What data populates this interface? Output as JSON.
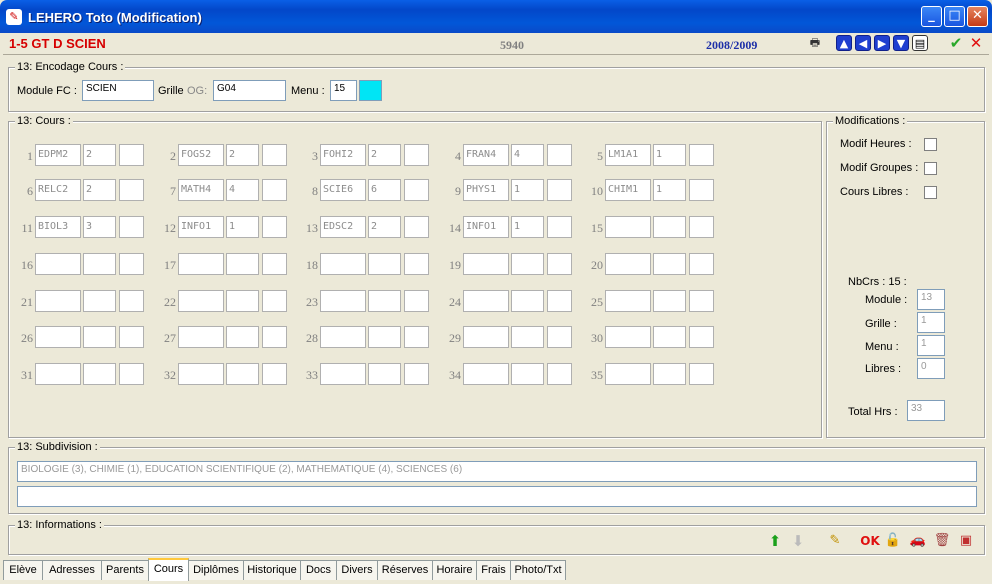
{
  "window": {
    "title": "LEHERO Toto (Modification)"
  },
  "infobar": {
    "code": "1-5 GT D SCIEN",
    "number": "5940",
    "year": "2008/2009"
  },
  "encodage": {
    "legend": "13: Encodage Cours :",
    "module_label": "Module FC :",
    "module_value": "SCIEN",
    "grille_label": "Grille",
    "og_label": "OG:",
    "grille_value": "G04",
    "menu_label": "Menu :",
    "menu_value": "15"
  },
  "cours": {
    "legend": "13: Cours :",
    "items": [
      {
        "n": "1",
        "code": "EDPM2",
        "hrs": "2"
      },
      {
        "n": "2",
        "code": "FOGS2",
        "hrs": "2"
      },
      {
        "n": "3",
        "code": "FOHI2",
        "hrs": "2"
      },
      {
        "n": "4",
        "code": "FRAN4",
        "hrs": "4"
      },
      {
        "n": "5",
        "code": "LM1A1",
        "hrs": "1"
      },
      {
        "n": "6",
        "code": "RELC2",
        "hrs": "2"
      },
      {
        "n": "7",
        "code": "MATH4",
        "hrs": "4"
      },
      {
        "n": "8",
        "code": "SCIE6",
        "hrs": "6"
      },
      {
        "n": "9",
        "code": "PHYS1",
        "hrs": "1"
      },
      {
        "n": "10",
        "code": "CHIM1",
        "hrs": "1"
      },
      {
        "n": "11",
        "code": "BIOL3",
        "hrs": "3"
      },
      {
        "n": "12",
        "code": "INFO1",
        "hrs": "1"
      },
      {
        "n": "13",
        "code": "EDSC2",
        "hrs": "2"
      },
      {
        "n": "14",
        "code": "INFO1",
        "hrs": "1"
      },
      {
        "n": "15",
        "code": "",
        "hrs": ""
      },
      {
        "n": "16",
        "code": "",
        "hrs": ""
      },
      {
        "n": "17",
        "code": "",
        "hrs": ""
      },
      {
        "n": "18",
        "code": "",
        "hrs": ""
      },
      {
        "n": "19",
        "code": "",
        "hrs": ""
      },
      {
        "n": "20",
        "code": "",
        "hrs": ""
      },
      {
        "n": "21",
        "code": "",
        "hrs": ""
      },
      {
        "n": "22",
        "code": "",
        "hrs": ""
      },
      {
        "n": "23",
        "code": "",
        "hrs": ""
      },
      {
        "n": "24",
        "code": "",
        "hrs": ""
      },
      {
        "n": "25",
        "code": "",
        "hrs": ""
      },
      {
        "n": "26",
        "code": "",
        "hrs": ""
      },
      {
        "n": "27",
        "code": "",
        "hrs": ""
      },
      {
        "n": "28",
        "code": "",
        "hrs": ""
      },
      {
        "n": "29",
        "code": "",
        "hrs": ""
      },
      {
        "n": "30",
        "code": "",
        "hrs": ""
      },
      {
        "n": "31",
        "code": "",
        "hrs": ""
      },
      {
        "n": "32",
        "code": "",
        "hrs": ""
      },
      {
        "n": "33",
        "code": "",
        "hrs": ""
      },
      {
        "n": "34",
        "code": "",
        "hrs": ""
      },
      {
        "n": "35",
        "code": "",
        "hrs": ""
      }
    ]
  },
  "modifications": {
    "legend": "Modifications :",
    "modif_heures": "Modif Heures :",
    "modif_groupes": "Modif Groupes :",
    "cours_libres": "Cours Libres :",
    "nbcrs": "NbCrs : 15 :",
    "module_label": "Module :",
    "module_value": "13",
    "grille_label": "Grille :",
    "grille_value": "1",
    "menu_label": "Menu :",
    "menu_value": "1",
    "libres_label": "Libres :",
    "libres_value": "0",
    "total_label": "Total Hrs :",
    "total_value": "33"
  },
  "subdivision": {
    "legend": "13: Subdivision :",
    "text": "BIOLOGIE (3), CHIMIE (1), EDUCATION SCIENTIFIQUE (2), MATHEMATIQUE (4), SCIENCES (6)",
    "text2": ""
  },
  "informations": {
    "legend": "13: Informations :",
    "ok_label": "OK"
  },
  "tabs": [
    "Elève",
    "Adresses",
    "Parents",
    "Cours",
    "Diplômes",
    "Historique",
    "Docs",
    "Divers",
    "Réserves",
    "Horaire",
    "Frais",
    "Photo/Txt"
  ],
  "colors": {
    "accent_red": "#d60000",
    "year_blue": "#1c2fa8",
    "menu_swatch": "#00e5f5"
  }
}
